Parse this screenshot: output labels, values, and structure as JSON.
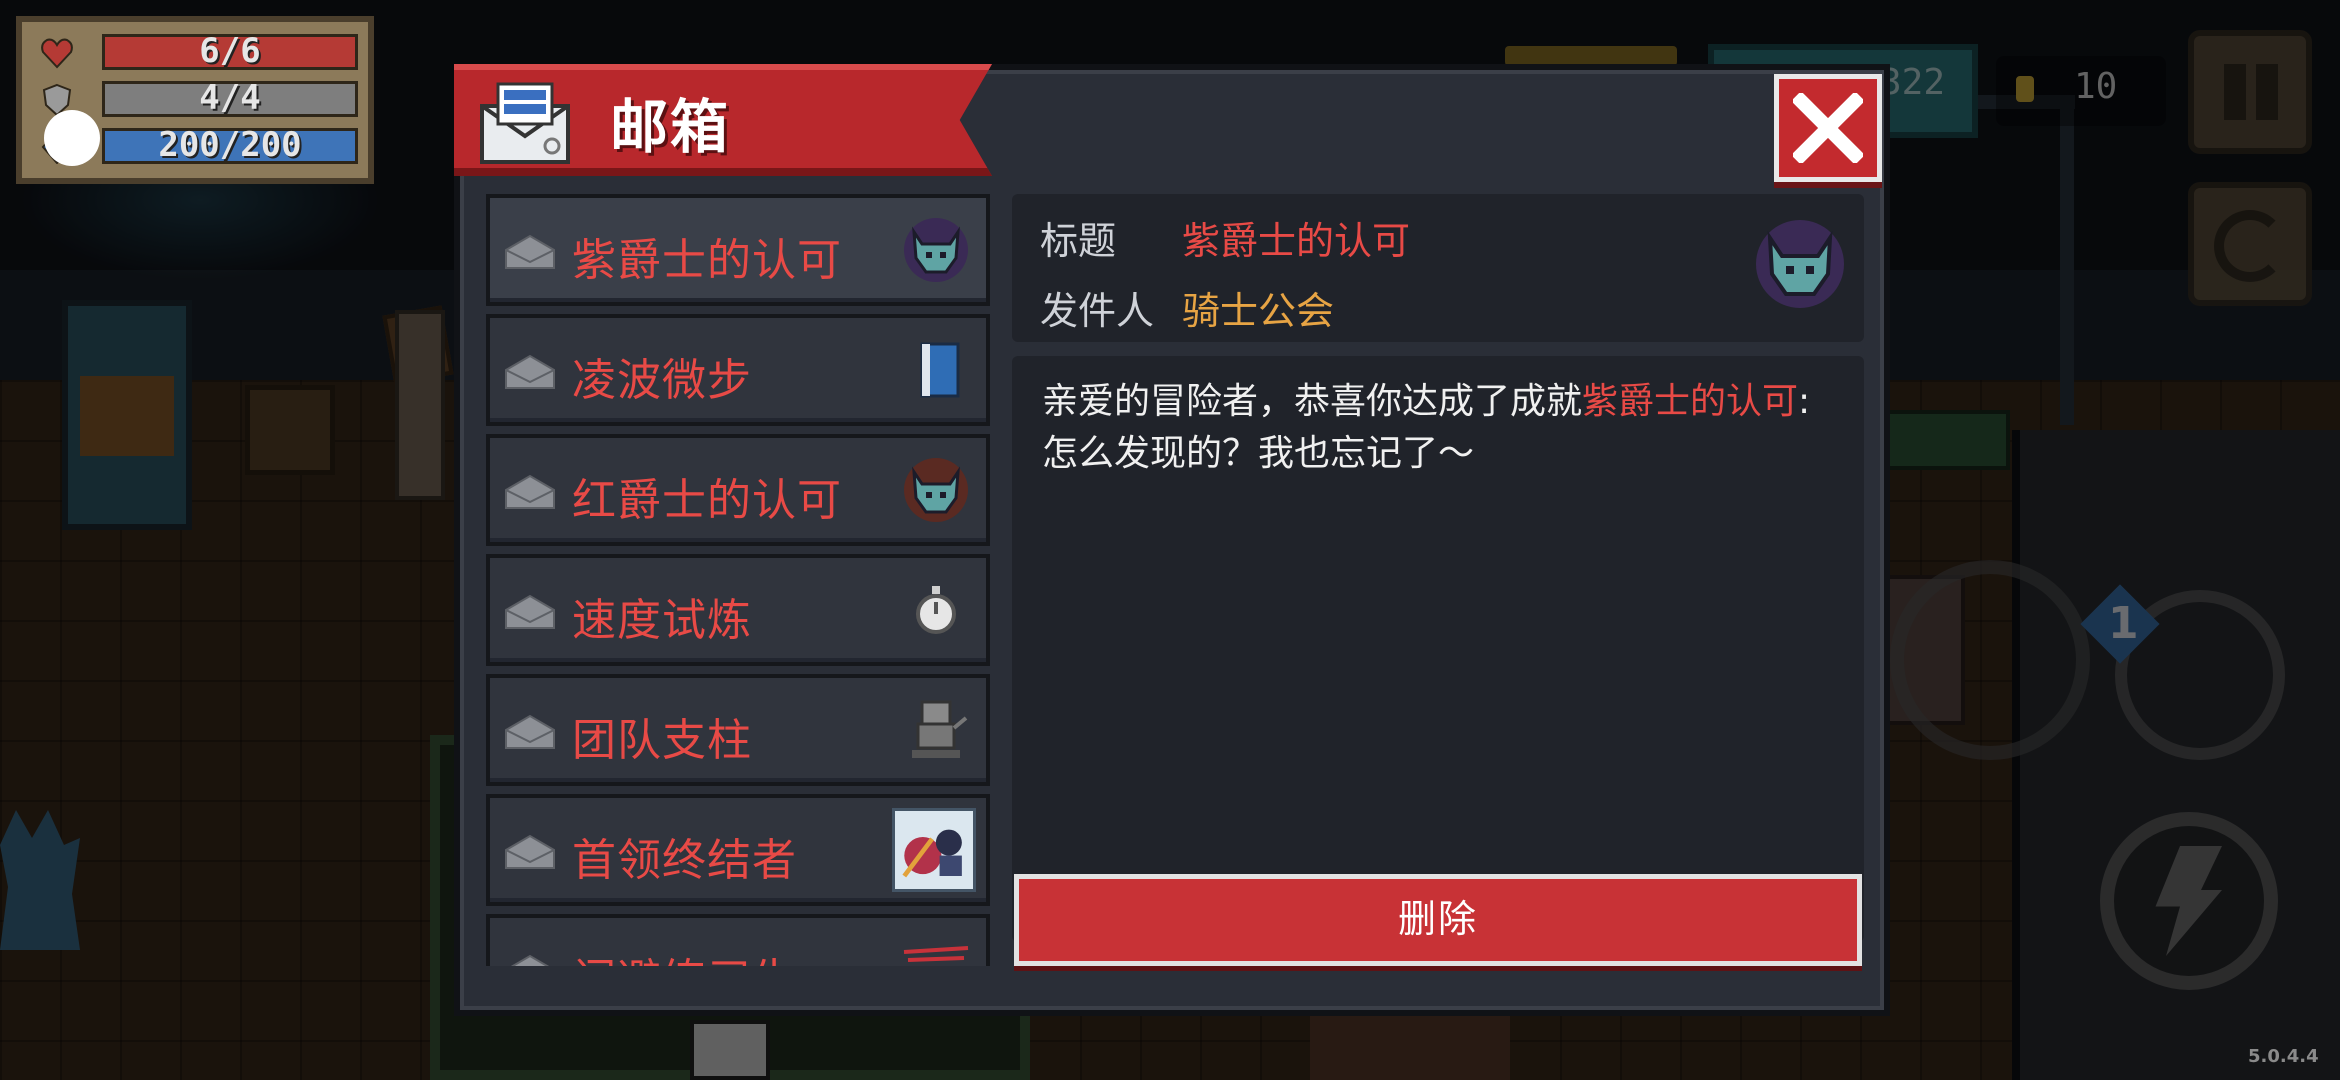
{
  "hud": {
    "hp": "6/6",
    "armor": "4/4",
    "energy": "200/200",
    "gems": "322",
    "coins": "10",
    "weapon_slot": "1",
    "version": "5.0.4.4"
  },
  "mailbox": {
    "title": "邮箱",
    "close_icon": "close-x-icon",
    "items": [
      {
        "label": "紫爵士的认可",
        "icon": "purple-knight-helmet-icon",
        "selected": true
      },
      {
        "label": "凌波微步",
        "icon": "blue-book-icon"
      },
      {
        "label": "红爵士的认可",
        "icon": "red-knight-helmet-icon"
      },
      {
        "label": "速度试炼",
        "icon": "stopwatch-icon"
      },
      {
        "label": "团队支柱",
        "icon": "robot-statue-icon"
      },
      {
        "label": "首领终结者",
        "icon": "boss-portrait-icon"
      },
      {
        "label": "闪避练习生",
        "icon": "red-slash-icon"
      }
    ],
    "detail": {
      "title_label": "标题",
      "title_value": "紫爵士的认可",
      "sender_label": "发件人",
      "sender_value": "骑士公会",
      "body_prefix": "亲爱的冒险者，恭喜你达成了成就",
      "body_highlight": "紫爵士的认可",
      "body_colon": ":",
      "body_line2": "怎么发现的？我也忘记了～",
      "delete_label": "删除"
    }
  },
  "colors": {
    "accent_red": "#e84a46",
    "sender_gold": "#e7a444",
    "panel_bg": "#2a2e37"
  }
}
